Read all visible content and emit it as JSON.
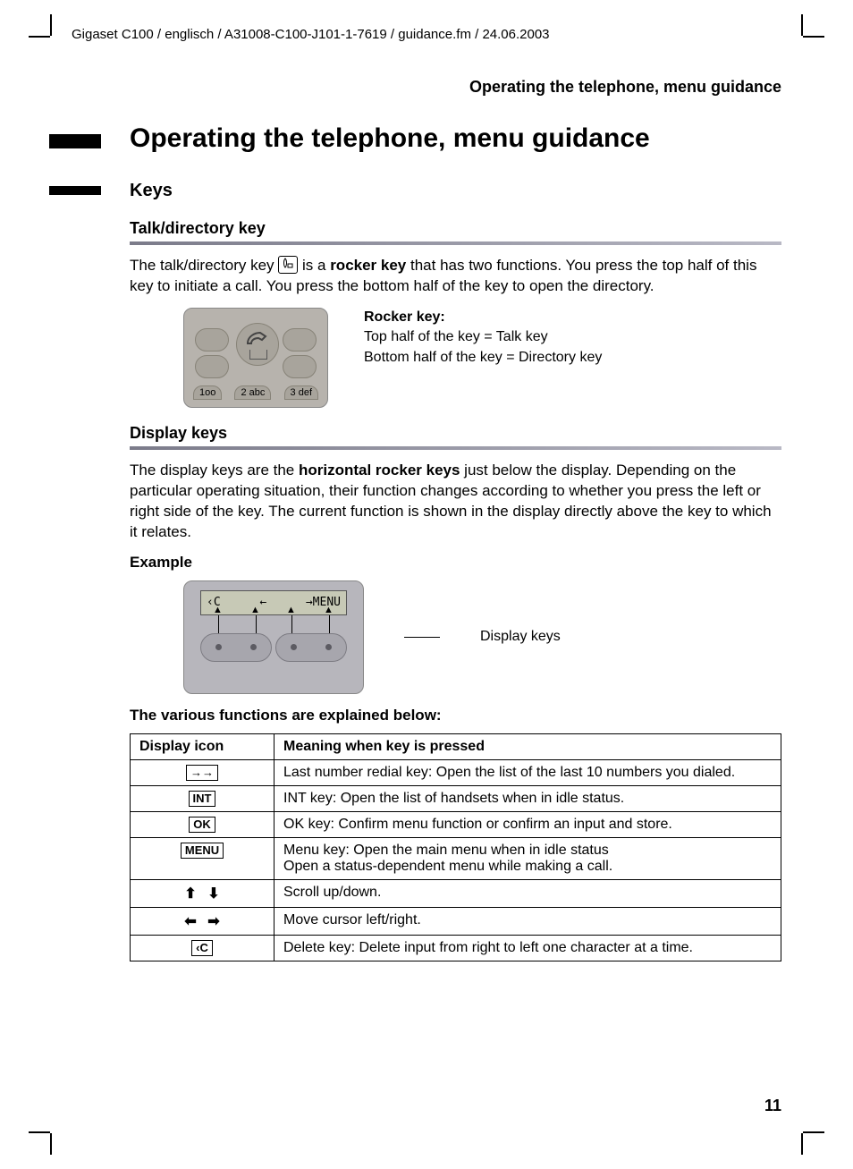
{
  "meta": {
    "docline": "Gigaset C100 / englisch / A31008-C100-J101-1-7619 / guidance.fm / 24.06.2003",
    "running_header": "Operating the telephone, menu guidance",
    "page_number": "11"
  },
  "title": "Operating the telephone, menu guidance",
  "keys_section": {
    "heading": "Keys"
  },
  "talk": {
    "heading": "Talk/directory key",
    "para1a": "The talk/directory key ",
    "para1b": " is a ",
    "rocker_key_bold": "rocker key",
    "para1c": " that has two functions. You press the top half of this key to initiate a call. You press the bottom half of the key to open the directory.",
    "fig_label_header": "Rocker key:",
    "fig_label_top": "Top half of the key = Talk key",
    "fig_label_bottom": "Bottom half of the key = Directory key"
  },
  "display": {
    "heading": "Display keys",
    "para_a": "The display keys are the ",
    "hrk_bold": "horizontal rocker keys",
    "para_b": " just below the display. Depending on the particular operating situation, their function changes according to whether you press the left or right side of the key. The current function is shown in the display directly above the key to which it relates.",
    "example_label": "Example",
    "fig2_label": "Display keys",
    "screen_left": "‹C",
    "screen_mid_left": "←",
    "screen_mid_right": "→MENU"
  },
  "functions_intro": "The various functions are explained below:",
  "table": {
    "head_icon": "Display icon",
    "head_meaning": "Meaning when key is pressed",
    "rows": [
      {
        "icon": "→→",
        "boxed": true,
        "meaning": "Last number redial key: Open the list of the last 10 numbers you dialed."
      },
      {
        "icon": "INT",
        "boxed": true,
        "meaning": "INT key: Open the list of handsets when in idle status."
      },
      {
        "icon": "OK",
        "boxed": true,
        "meaning": "OK key: Confirm menu function or confirm an input and store."
      },
      {
        "icon": "MENU",
        "boxed": true,
        "meaning": "Menu key: Open the main menu when in idle status\nOpen a status-dependent menu while making a call."
      },
      {
        "icon": "updown",
        "boxed": false,
        "meaning": "Scroll up/down."
      },
      {
        "icon": "leftright",
        "boxed": false,
        "meaning": "Move cursor left/right."
      },
      {
        "icon": "‹C",
        "boxed": true,
        "meaning": "Delete key: Delete input from right to left one character at a time."
      }
    ]
  }
}
